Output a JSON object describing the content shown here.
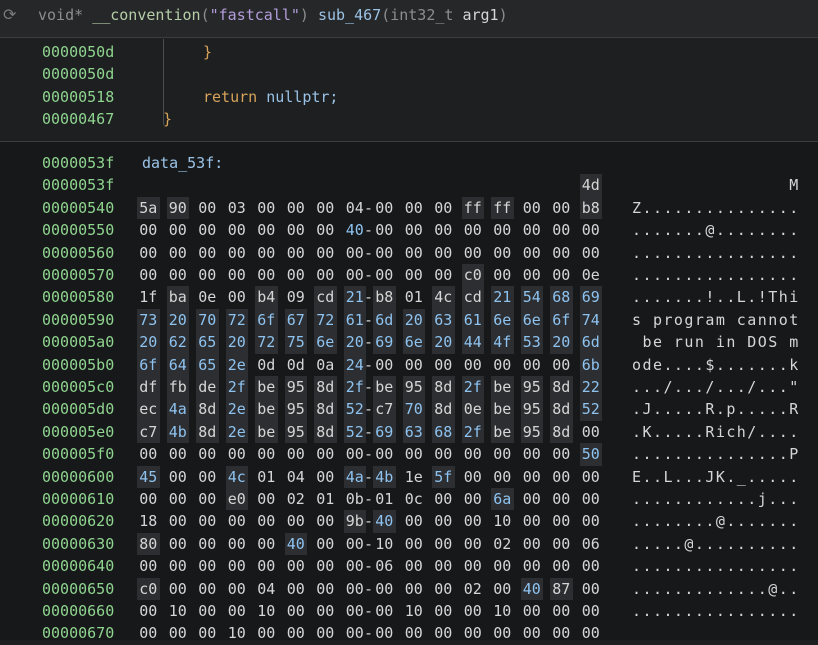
{
  "header": {
    "signature_parts": [
      {
        "t": "void",
        "c": "kw"
      },
      {
        "t": "* ",
        "c": "kw"
      },
      {
        "t": "__convention",
        "c": "fn"
      },
      {
        "t": "(",
        "c": "kw"
      },
      {
        "t": "\"fastcall\"",
        "c": "str"
      },
      {
        "t": ") ",
        "c": "kw"
      },
      {
        "t": "sub_467",
        "c": "fnname"
      },
      {
        "t": "(",
        "c": "kw"
      },
      {
        "t": "int32_t ",
        "c": "kw"
      },
      {
        "t": "arg1",
        "c": "param"
      },
      {
        "t": ")",
        "c": "kw"
      }
    ]
  },
  "code": [
    {
      "addr": "0000050d",
      "text": "}",
      "cls": "brace",
      "indent": 203
    },
    {
      "addr": "0000050d",
      "text": "",
      "cls": "",
      "indent": 203
    },
    {
      "addr": "00000518",
      "text": "return",
      "cls": "ret",
      "indent": 203,
      "extra": " nullptr;"
    },
    {
      "addr": "00000467",
      "text": "}",
      "cls": "brace",
      "indent": 163
    }
  ],
  "hex": {
    "label": "data_53f:",
    "rows": [
      {
        "addr": "0000053f",
        "label": true
      },
      {
        "addr": "0000053f",
        "bytes": [
          "",
          "",
          "",
          "",
          "",
          "",
          "",
          "",
          "",
          "",
          "",
          "",
          "",
          "",
          "",
          "4d"
        ],
        "hl": [
          15
        ],
        "blue": [],
        "ascii": "               M"
      },
      {
        "addr": "00000540",
        "bytes": [
          "5a",
          "90",
          "00",
          "03",
          "00",
          "00",
          "00",
          "04",
          "00",
          "00",
          "00",
          "ff",
          "ff",
          "00",
          "00",
          "b8"
        ],
        "hl": [
          0,
          1,
          11,
          12,
          15
        ],
        "blue": [],
        "ascii": "Z..............."
      },
      {
        "addr": "00000550",
        "bytes": [
          "00",
          "00",
          "00",
          "00",
          "00",
          "00",
          "00",
          "40",
          "00",
          "00",
          "00",
          "00",
          "00",
          "00",
          "00",
          "00"
        ],
        "hl": [],
        "blue": [
          7
        ],
        "ascii": ".......@........"
      },
      {
        "addr": "00000560",
        "bytes": [
          "00",
          "00",
          "00",
          "00",
          "00",
          "00",
          "00",
          "00",
          "00",
          "00",
          "00",
          "00",
          "00",
          "00",
          "00",
          "00"
        ],
        "hl": [],
        "blue": [],
        "ascii": "................"
      },
      {
        "addr": "00000570",
        "bytes": [
          "00",
          "00",
          "00",
          "00",
          "00",
          "00",
          "00",
          "00",
          "00",
          "00",
          "00",
          "c0",
          "00",
          "00",
          "00",
          "0e"
        ],
        "hl": [
          11
        ],
        "blue": [],
        "ascii": "................"
      },
      {
        "addr": "00000580",
        "bytes": [
          "1f",
          "ba",
          "0e",
          "00",
          "b4",
          "09",
          "cd",
          "21",
          "b8",
          "01",
          "4c",
          "cd",
          "21",
          "54",
          "68",
          "69"
        ],
        "hl": [
          1,
          4,
          6,
          7,
          8,
          10,
          11,
          12,
          13,
          14,
          15
        ],
        "blue": [
          7,
          12,
          13,
          14,
          15
        ],
        "ascii": ".......!..L.!Thi"
      },
      {
        "addr": "00000590",
        "bytes": [
          "73",
          "20",
          "70",
          "72",
          "6f",
          "67",
          "72",
          "61",
          "6d",
          "20",
          "63",
          "61",
          "6e",
          "6e",
          "6f",
          "74"
        ],
        "hl": [
          0,
          1,
          2,
          3,
          4,
          5,
          6,
          7,
          8,
          9,
          10,
          11,
          12,
          13,
          14,
          15
        ],
        "blue": [
          0,
          1,
          2,
          3,
          4,
          5,
          6,
          7,
          8,
          9,
          10,
          11,
          12,
          13,
          14,
          15
        ],
        "ascii": "s program cannot"
      },
      {
        "addr": "000005a0",
        "bytes": [
          "20",
          "62",
          "65",
          "20",
          "72",
          "75",
          "6e",
          "20",
          "69",
          "6e",
          "20",
          "44",
          "4f",
          "53",
          "20",
          "6d"
        ],
        "hl": [
          0,
          1,
          2,
          3,
          4,
          5,
          6,
          7,
          8,
          9,
          10,
          11,
          12,
          13,
          14,
          15
        ],
        "blue": [
          0,
          1,
          2,
          3,
          4,
          5,
          6,
          7,
          8,
          9,
          10,
          11,
          12,
          13,
          14,
          15
        ],
        "ascii": " be run in DOS m"
      },
      {
        "addr": "000005b0",
        "bytes": [
          "6f",
          "64",
          "65",
          "2e",
          "0d",
          "0d",
          "0a",
          "24",
          "00",
          "00",
          "00",
          "00",
          "00",
          "00",
          "00",
          "6b"
        ],
        "hl": [
          0,
          1,
          2,
          3,
          7,
          15
        ],
        "blue": [
          0,
          1,
          2,
          3,
          7,
          15
        ],
        "ascii": "ode....$.......k"
      },
      {
        "addr": "000005c0",
        "bytes": [
          "df",
          "fb",
          "de",
          "2f",
          "be",
          "95",
          "8d",
          "2f",
          "be",
          "95",
          "8d",
          "2f",
          "be",
          "95",
          "8d",
          "22"
        ],
        "hl": [
          0,
          1,
          2,
          3,
          4,
          5,
          6,
          7,
          8,
          9,
          10,
          11,
          12,
          13,
          14,
          15
        ],
        "blue": [
          3,
          7,
          11,
          15
        ],
        "ascii": ".../.../.../...\""
      },
      {
        "addr": "000005d0",
        "bytes": [
          "ec",
          "4a",
          "8d",
          "2e",
          "be",
          "95",
          "8d",
          "52",
          "c7",
          "70",
          "8d",
          "0e",
          "be",
          "95",
          "8d",
          "52"
        ],
        "hl": [
          0,
          1,
          2,
          3,
          4,
          5,
          6,
          7,
          8,
          9,
          10,
          11,
          12,
          13,
          14,
          15
        ],
        "blue": [
          1,
          3,
          7,
          9,
          15
        ],
        "ascii": ".J.....R.p.....R"
      },
      {
        "addr": "000005e0",
        "bytes": [
          "c7",
          "4b",
          "8d",
          "2e",
          "be",
          "95",
          "8d",
          "52",
          "69",
          "63",
          "68",
          "2f",
          "be",
          "95",
          "8d",
          "00"
        ],
        "hl": [
          0,
          1,
          2,
          3,
          4,
          5,
          6,
          7,
          8,
          9,
          10,
          11,
          12,
          13,
          14
        ],
        "blue": [
          1,
          3,
          7,
          8,
          9,
          10,
          11
        ],
        "ascii": ".K.....Rich/...."
      },
      {
        "addr": "000005f0",
        "bytes": [
          "00",
          "00",
          "00",
          "00",
          "00",
          "00",
          "00",
          "00",
          "00",
          "00",
          "00",
          "00",
          "00",
          "00",
          "00",
          "50"
        ],
        "hl": [
          15
        ],
        "blue": [
          15
        ],
        "ascii": "...............P"
      },
      {
        "addr": "00000600",
        "bytes": [
          "45",
          "00",
          "00",
          "4c",
          "01",
          "04",
          "00",
          "4a",
          "4b",
          "1e",
          "5f",
          "00",
          "00",
          "00",
          "00",
          "00"
        ],
        "hl": [
          0,
          3,
          7,
          8,
          10
        ],
        "blue": [
          0,
          3,
          7,
          8,
          10
        ],
        "ascii": "E..L...JK._....."
      },
      {
        "addr": "00000610",
        "bytes": [
          "00",
          "00",
          "00",
          "e0",
          "00",
          "02",
          "01",
          "0b",
          "01",
          "0c",
          "00",
          "00",
          "6a",
          "00",
          "00",
          "00"
        ],
        "hl": [
          3,
          12
        ],
        "blue": [
          12
        ],
        "ascii": "............j..."
      },
      {
        "addr": "00000620",
        "bytes": [
          "18",
          "00",
          "00",
          "00",
          "00",
          "00",
          "00",
          "9b",
          "40",
          "00",
          "00",
          "00",
          "10",
          "00",
          "00",
          "00"
        ],
        "hl": [
          7,
          8
        ],
        "blue": [
          8
        ],
        "ascii": "........@......."
      },
      {
        "addr": "00000630",
        "bytes": [
          "80",
          "00",
          "00",
          "00",
          "00",
          "40",
          "00",
          "00",
          "10",
          "00",
          "00",
          "00",
          "02",
          "00",
          "00",
          "06"
        ],
        "hl": [
          0,
          5
        ],
        "blue": [
          5
        ],
        "ascii": ".....@.........."
      },
      {
        "addr": "00000640",
        "bytes": [
          "00",
          "00",
          "00",
          "00",
          "00",
          "00",
          "00",
          "00",
          "06",
          "00",
          "00",
          "00",
          "00",
          "00",
          "00",
          "00"
        ],
        "hl": [],
        "blue": [],
        "ascii": "................"
      },
      {
        "addr": "00000650",
        "bytes": [
          "c0",
          "00",
          "00",
          "00",
          "04",
          "00",
          "00",
          "00",
          "00",
          "00",
          "00",
          "02",
          "00",
          "40",
          "87",
          "00"
        ],
        "hl": [
          0,
          13,
          14
        ],
        "blue": [
          13
        ],
        "ascii": ".............@.."
      },
      {
        "addr": "00000660",
        "bytes": [
          "00",
          "10",
          "00",
          "00",
          "10",
          "00",
          "00",
          "00",
          "00",
          "10",
          "00",
          "00",
          "10",
          "00",
          "00",
          "00"
        ],
        "hl": [],
        "blue": [],
        "ascii": "................"
      },
      {
        "addr": "00000670",
        "bytes": [
          "00",
          "00",
          "00",
          "10",
          "00",
          "00",
          "00",
          "00",
          "00",
          "00",
          "00",
          "00",
          "00",
          "00",
          "00",
          "00"
        ],
        "hl": [],
        "blue": [],
        "ascii": ""
      }
    ]
  }
}
